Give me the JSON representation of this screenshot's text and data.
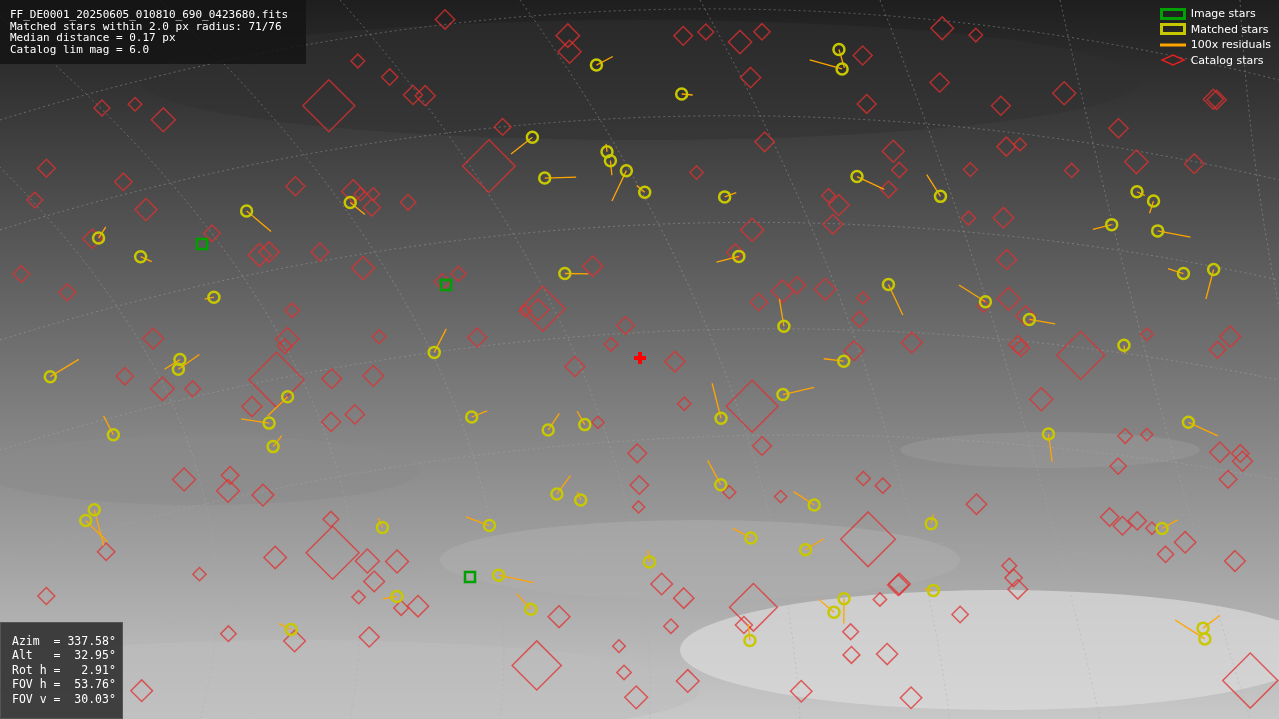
{
  "info_box": {
    "lines": [
      "FF_DE0001_20250605_010810_690_0423680.fits",
      "Matched stars within 2.0 px radius: 71/76",
      "Median distance = 0.17 px",
      "Catalog lim mag = 6.0"
    ]
  },
  "legend": [
    {
      "kind": "square",
      "label": "Image stars",
      "color": "#00a000"
    },
    {
      "kind": "square",
      "label": "Matched stars",
      "color": "#c8c800"
    },
    {
      "kind": "line",
      "label": "100x residuals",
      "color": "#ffa500"
    },
    {
      "kind": "diamond",
      "label": "Catalog stars",
      "color": "#e02020"
    }
  ],
  "pointing_box": {
    "lines": [
      "Azim  = 337.58°",
      "Alt   =  32.95°",
      "Rot h =   2.91°",
      "FOV h =  53.76°",
      "FOV v =  30.03°"
    ]
  }
}
